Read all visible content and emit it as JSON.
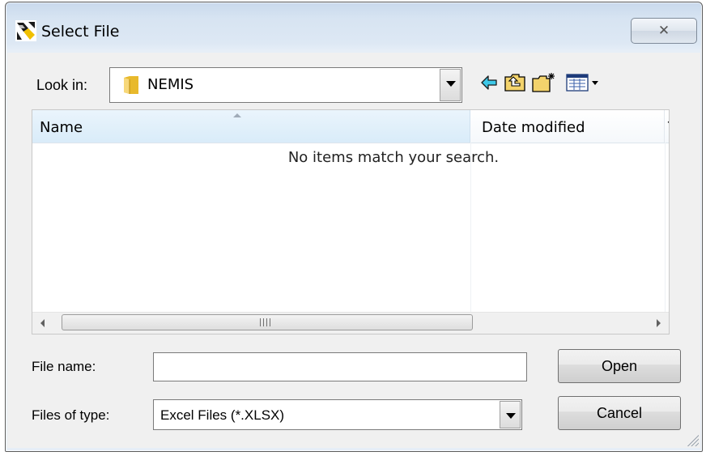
{
  "window": {
    "title": "Select File",
    "close_glyph": "✕",
    "title_icon": "app-logo-icon"
  },
  "toolbar": {
    "look_in_label": "Look in:",
    "look_in_value": "NEMIS",
    "icons": [
      "back-arrow-icon",
      "up-folder-icon",
      "new-folder-icon",
      "view-menu-icon"
    ]
  },
  "list": {
    "columns": [
      "Name",
      "Date modified",
      "Ty"
    ],
    "sorted_column": "Name",
    "empty_message": "No items match your search."
  },
  "scrollbar": {
    "grip": "III"
  },
  "form": {
    "file_name_label": "File name:",
    "file_name_value": "",
    "files_of_type_label": "Files of type:",
    "files_of_type_value": "Excel Files (*.XLSX)"
  },
  "buttons": {
    "open_label": "Open",
    "cancel_label": "Cancel"
  },
  "colors": {
    "accent": "#e0a400",
    "header_selected": "#d9ecf9"
  }
}
